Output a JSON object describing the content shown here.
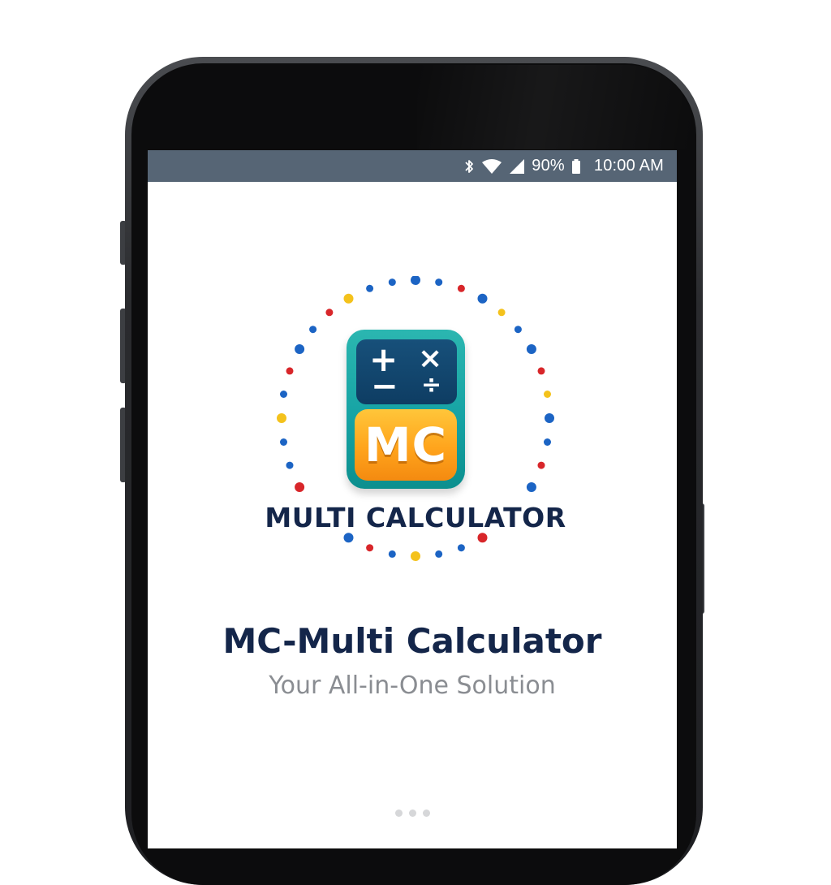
{
  "status_bar": {
    "battery": "90%",
    "time": "10:00 AM",
    "icons": [
      "bluetooth-icon",
      "wifi-icon",
      "signal-icon",
      "battery-icon"
    ],
    "background_color": "#566575"
  },
  "logo": {
    "icon_ops": [
      "+",
      "×",
      "−",
      "÷"
    ],
    "icon_initials": "MC",
    "wordmark": "MULTI CALCULATOR"
  },
  "splash": {
    "title": "MC-Multi Calculator",
    "tagline": "Your All-in-One Solution"
  },
  "pager": {
    "count": 3
  },
  "colors": {
    "brand_navy": "#14264a",
    "teal": "#16a3a4",
    "orange": "#ffa41c",
    "dot_blue": "#1c64c4",
    "dot_red": "#d8262a",
    "dot_yellow": "#f4c21c"
  }
}
